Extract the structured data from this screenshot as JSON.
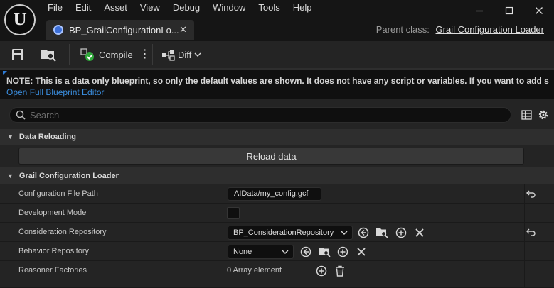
{
  "menu": [
    "File",
    "Edit",
    "Asset",
    "View",
    "Debug",
    "Window",
    "Tools",
    "Help"
  ],
  "tab": {
    "label": "BP_GrailConfigurationLo..."
  },
  "parent_class": {
    "label": "Parent class:",
    "value": "Grail Configuration Loader"
  },
  "toolbar": {
    "compile_label": "Compile",
    "diff_label": "Diff"
  },
  "note": {
    "text": "NOTE: This is a data only blueprint, so only the default values are shown.  It does not have any script or variables.  If you want to add s",
    "link": "Open Full Blueprint Editor"
  },
  "search": {
    "placeholder": "Search"
  },
  "sections": {
    "data_reloading": {
      "title": "Data Reloading",
      "reload_label": "Reload data"
    },
    "loader": {
      "title": "Grail Configuration Loader"
    }
  },
  "properties": {
    "config_path": {
      "label": "Configuration File Path",
      "value": "AIData/my_config.gcf"
    },
    "dev_mode": {
      "label": "Development Mode",
      "checked": false
    },
    "consideration_repo": {
      "label": "Consideration Repository",
      "value": "BP_ConsiderationRepository"
    },
    "behavior_repo": {
      "label": "Behavior Repository",
      "value": "None"
    },
    "reasoner_factories": {
      "label": "Reasoner Factories",
      "value": "0 Array element"
    }
  }
}
